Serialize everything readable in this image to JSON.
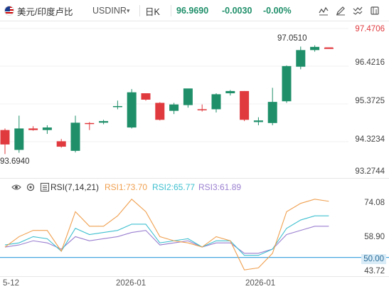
{
  "toolbar": {
    "title": "美元/印度卢比",
    "symbol": "USDINR",
    "caret": "▾",
    "period": "日K",
    "price": "96.9690",
    "change": "-0.0030",
    "change_pct": "-0.00%",
    "tools": [
      "indicator-icon",
      "draw-icon",
      "compare-icon",
      "settings-icon"
    ]
  },
  "price_axis": {
    "labels": [
      "97.4706",
      "96.4216",
      "95.3725",
      "94.3234",
      "93.2744"
    ],
    "last_price_marker": "97.4706"
  },
  "annotations": {
    "high": "97.0510",
    "low": "93.6940"
  },
  "rsi": {
    "label": "RSI(7,14,21)",
    "rsi1": "RSI1:73.70",
    "rsi2": "RSI2:65.77",
    "rsi3": "RSI3:61.89",
    "axis_labels": [
      "74.08",
      "58.90",
      "50.00",
      "43.72"
    ]
  },
  "x_axis": {
    "labels": [
      "5-12",
      "2026-01",
      "2026-01"
    ]
  },
  "colors": {
    "up": "#1f8f6a",
    "down": "#e0393e",
    "rsi1": "#f0a050",
    "rsi2": "#3fc0d0",
    "rsi3": "#9a7fd0",
    "rsi_ref": "#4aa8e0"
  },
  "chart_data": {
    "type": "candlestick",
    "ylim": [
      93.08,
      97.62
    ],
    "candles": [
      {
        "o": 94.4,
        "h": 94.45,
        "l": 93.65,
        "c": 93.95
      },
      {
        "o": 93.78,
        "h": 94.85,
        "l": 93.69,
        "c": 94.45
      },
      {
        "o": 94.45,
        "h": 94.52,
        "l": 94.38,
        "c": 94.4
      },
      {
        "o": 94.4,
        "h": 94.55,
        "l": 94.28,
        "c": 94.48
      },
      {
        "o": 94.05,
        "h": 94.12,
        "l": 93.85,
        "c": 93.88
      },
      {
        "o": 93.75,
        "h": 94.85,
        "l": 93.7,
        "c": 94.63
      },
      {
        "o": 94.62,
        "h": 94.65,
        "l": 94.4,
        "c": 94.6
      },
      {
        "o": 94.63,
        "h": 94.72,
        "l": 94.58,
        "c": 94.68
      },
      {
        "o": 95.15,
        "h": 95.32,
        "l": 95.05,
        "c": 95.15
      },
      {
        "o": 94.48,
        "h": 95.68,
        "l": 94.45,
        "c": 95.58
      },
      {
        "o": 95.55,
        "h": 95.55,
        "l": 95.32,
        "c": 95.35
      },
      {
        "o": 95.25,
        "h": 95.27,
        "l": 94.7,
        "c": 94.72
      },
      {
        "o": 95.0,
        "h": 95.25,
        "l": 94.9,
        "c": 95.2
      },
      {
        "o": 95.18,
        "h": 95.65,
        "l": 95.1,
        "c": 95.7
      },
      {
        "o": 95.05,
        "h": 95.2,
        "l": 94.98,
        "c": 95.02
      },
      {
        "o": 95.05,
        "h": 95.55,
        "l": 94.95,
        "c": 95.52
      },
      {
        "o": 95.55,
        "h": 95.65,
        "l": 95.48,
        "c": 95.62
      },
      {
        "o": 95.62,
        "h": 95.62,
        "l": 94.68,
        "c": 94.72
      },
      {
        "o": 94.65,
        "h": 94.8,
        "l": 94.55,
        "c": 94.7
      },
      {
        "o": 94.62,
        "h": 95.72,
        "l": 94.55,
        "c": 95.28
      },
      {
        "o": 95.3,
        "h": 96.42,
        "l": 95.25,
        "c": 96.4
      },
      {
        "o": 96.38,
        "h": 97.01,
        "l": 96.3,
        "c": 96.9
      },
      {
        "o": 96.9,
        "h": 97.05,
        "l": 96.85,
        "c": 97.0
      },
      {
        "o": 96.97,
        "h": 96.97,
        "l": 96.97,
        "c": 96.969
      }
    ],
    "rsi_ylim": [
      42,
      80
    ],
    "rsi1": [
      55,
      60,
      63,
      63,
      53,
      72,
      65,
      65,
      70,
      78,
      72,
      60,
      58,
      57,
      55,
      60,
      58,
      44,
      45,
      52,
      72,
      76,
      78,
      77
    ],
    "rsi2": [
      56,
      57,
      60,
      59,
      53,
      64,
      61,
      62,
      63,
      66,
      66,
      57,
      58,
      59,
      55,
      58,
      58,
      51,
      51,
      54,
      64,
      68,
      70,
      70
    ],
    "rsi3": [
      55,
      56,
      58,
      57,
      54,
      60,
      58,
      59,
      60,
      62,
      63,
      56,
      57,
      58,
      55,
      57,
      57,
      52,
      52,
      54,
      61,
      63,
      65,
      65
    ],
    "rsi_ref_level": 50
  }
}
